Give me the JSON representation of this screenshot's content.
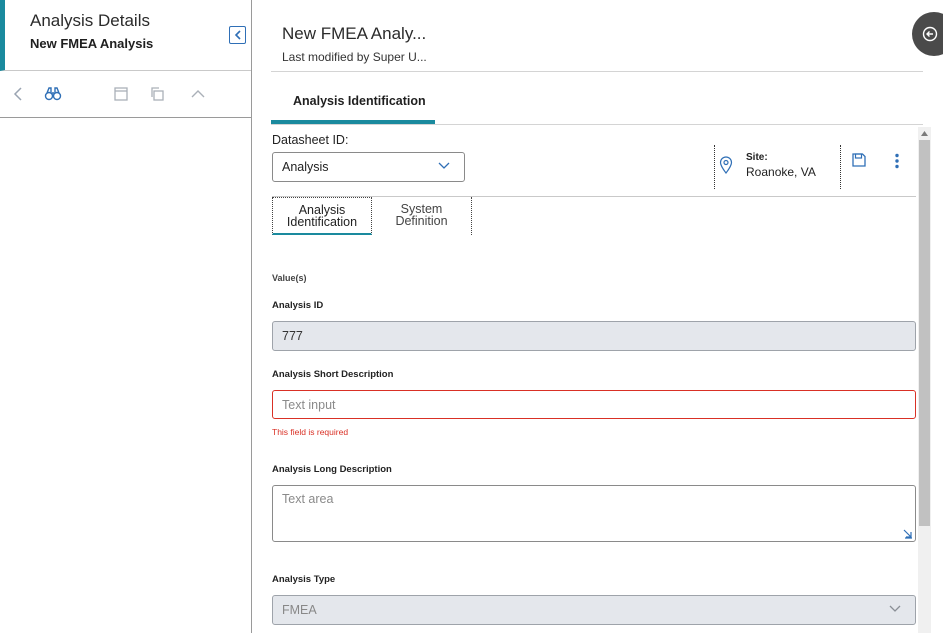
{
  "left_panel": {
    "title": "Analysis Details",
    "subtitle": "New FMEA Analysis"
  },
  "header": {
    "title": "New FMEA Analy...",
    "subtitle": "Last modified by Super U..."
  },
  "main_tabs": [
    {
      "label": "Analysis Identification",
      "active": true
    }
  ],
  "datasheet": {
    "label": "Datasheet ID:",
    "selected": "Analysis"
  },
  "site": {
    "label": "Site:",
    "value": "Roanoke, VA"
  },
  "sub_tabs": [
    {
      "line1": "Analysis",
      "line2": "Identification",
      "active": true
    },
    {
      "line1": "System",
      "line2": "Definition",
      "active": false
    }
  ],
  "form": {
    "values_label": "Value(s)",
    "analysis_id": {
      "label": "Analysis ID",
      "value": "777"
    },
    "short_description": {
      "label": "Analysis Short Description",
      "placeholder": "Text input",
      "error": "This field is required"
    },
    "long_description": {
      "label": "Analysis Long Description",
      "placeholder": "Text area"
    },
    "analysis_type": {
      "label": "Analysis Type",
      "value": "FMEA"
    }
  },
  "colors": {
    "accent": "#1a8a9e",
    "link_blue": "#2f6fb6",
    "error": "#d93025"
  }
}
